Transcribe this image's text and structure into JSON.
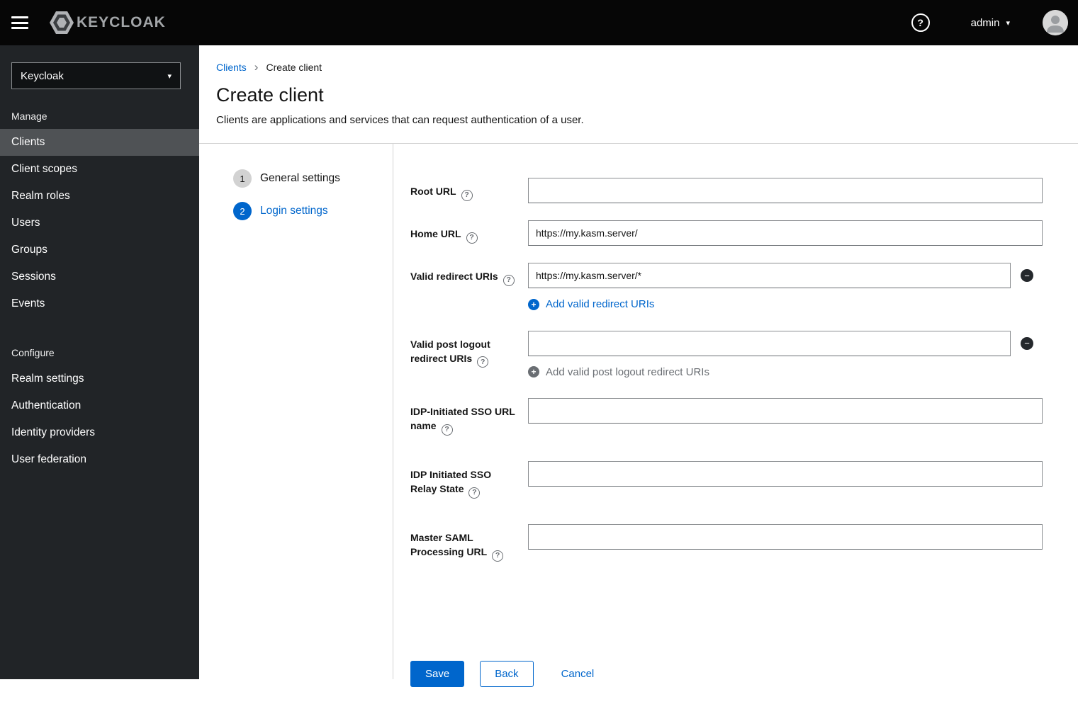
{
  "colors": {
    "accent": "#0066cc",
    "topbar_bg": "#060606",
    "sidebar_bg": "#212427",
    "sidebar_selected_bg": "#4f5255",
    "input_border": "#8a8d90"
  },
  "icons": {
    "question": "?",
    "plus": "+",
    "minus": "−",
    "caret_down": "▾",
    "breadcrumb_separator": "›"
  },
  "header": {
    "brand": "KEYCLOAK",
    "user_menu": "admin"
  },
  "sidebar": {
    "realm_selector": "Keycloak",
    "selected_item": "Clients",
    "sections": [
      {
        "label": "Manage",
        "items": [
          "Clients",
          "Client scopes",
          "Realm roles",
          "Users",
          "Groups",
          "Sessions",
          "Events"
        ]
      },
      {
        "label": "Configure",
        "items": [
          "Realm settings",
          "Authentication",
          "Identity providers",
          "User federation"
        ]
      }
    ]
  },
  "breadcrumb": {
    "items": [
      "Clients",
      "Create client"
    ]
  },
  "page": {
    "title": "Create client",
    "subtitle": "Clients are applications and services that can request authentication of a user."
  },
  "wizard": {
    "active_step": "Login settings",
    "steps": [
      {
        "number": "1",
        "label": "General settings"
      },
      {
        "number": "2",
        "label": "Login settings"
      }
    ]
  },
  "form": {
    "root_url": {
      "label": "Root URL",
      "value": ""
    },
    "home_url": {
      "label": "Home URL",
      "value": "https://my.kasm.server/"
    },
    "valid_redirect_uris": {
      "label": "Valid redirect URIs",
      "value": "https://my.kasm.server/*",
      "add_label": "Add valid redirect URIs"
    },
    "valid_post_logout": {
      "label_line1": "Valid post logout",
      "label_line2": "redirect URIs",
      "value": "",
      "add_label": "Add valid post logout redirect URIs"
    },
    "idp_sso_url_name": {
      "label_line1": "IDP-Initiated SSO URL",
      "label_line2": "name",
      "value": ""
    },
    "idp_sso_relay_state": {
      "label_line1": "IDP Initiated SSO",
      "label_line2": "Relay State",
      "value": ""
    },
    "master_saml_url": {
      "label_line1": "Master SAML",
      "label_line2": "Processing URL",
      "value": ""
    }
  },
  "actions": {
    "save": "Save",
    "back": "Back",
    "cancel": "Cancel"
  }
}
